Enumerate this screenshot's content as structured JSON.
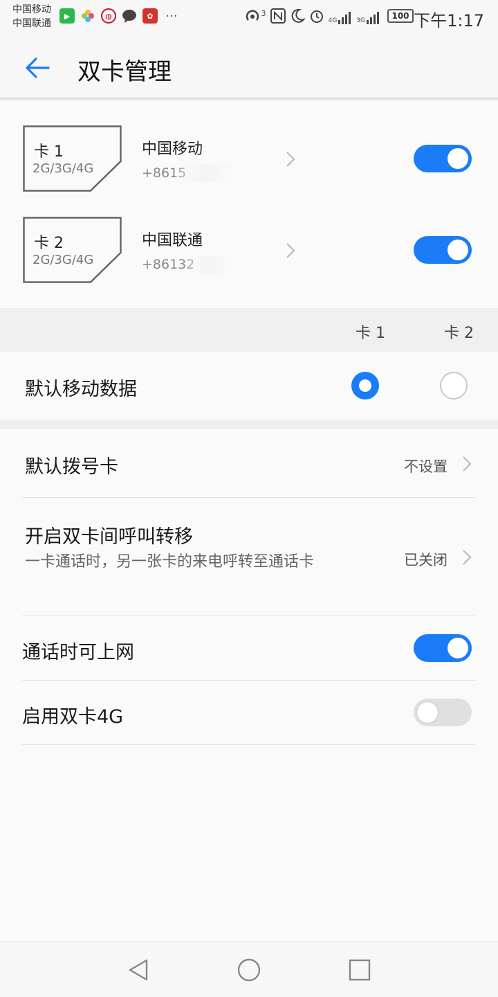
{
  "status_bar": {
    "carrier_1": "中国移动",
    "carrier_2": "中国联通",
    "hotspot_badge": "3",
    "net_1": "4G",
    "net_2": "3G",
    "battery": "100",
    "time": "下午1:17",
    "notification_icons": [
      "app-green-icon",
      "photos-petal-icon",
      "railway-icon",
      "chat-icon",
      "huawei-icon",
      "more-icon"
    ],
    "system_icons": [
      "hotspot-icon",
      "nfc-icon",
      "moon-icon",
      "alarm-icon",
      "signal-4g-icon",
      "signal-3g-icon",
      "battery-icon"
    ]
  },
  "header": {
    "title": "双卡管理",
    "back_icon": "back-arrow-icon"
  },
  "sims": [
    {
      "slot": "卡 1",
      "network": "2G/3G/4G",
      "carrier": "中国移动",
      "number_visible": "+8615",
      "enabled": true
    },
    {
      "slot": "卡 2",
      "network": "2G/3G/4G",
      "carrier": "中国联通",
      "number_visible": "+86132",
      "enabled": true
    }
  ],
  "columns": {
    "card1": "卡 1",
    "card2": "卡 2"
  },
  "default_data": {
    "label": "默认移动数据",
    "selected": "card1"
  },
  "settings": {
    "default_dial": {
      "label": "默认拨号卡",
      "value": "不设置"
    },
    "call_forward": {
      "label": "开启双卡间呼叫转移",
      "description": "一卡通话时，另一张卡的来电呼转至通话卡",
      "value": "已关闭"
    },
    "data_during_call": {
      "label": "通话时可上网",
      "enabled": true
    },
    "dual_4g": {
      "label": "启用双卡4G",
      "enabled": false
    }
  },
  "nav": {
    "back": "nav-back-icon",
    "home": "nav-home-icon",
    "recents": "nav-recents-icon"
  },
  "colors": {
    "accent": "#1a7cf6",
    "toggle_off": "#e0e0e0",
    "background": "#f7f7f7"
  }
}
